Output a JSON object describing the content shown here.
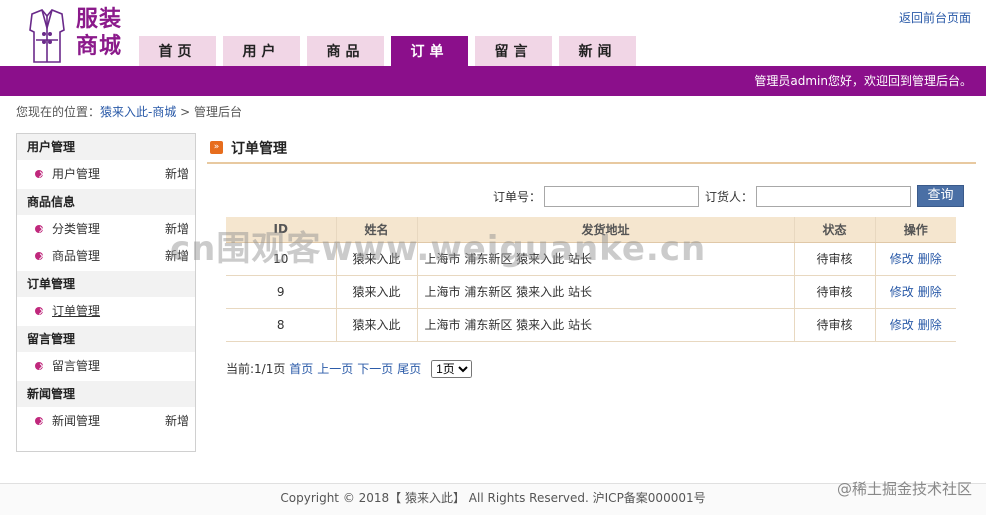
{
  "header": {
    "logo_text_line1": "服装",
    "logo_text_line2": "商城",
    "back_link": "返回前台页面",
    "nav": [
      "首页",
      "用户",
      "商品",
      "订单",
      "留言",
      "新闻"
    ],
    "active_nav": 3,
    "welcome": "管理员admin您好，欢迎回到管理后台。"
  },
  "breadcrumb": {
    "prefix": "您现在的位置：",
    "site": "猿来入此-商城",
    "sep": " > ",
    "current": "管理后台"
  },
  "sidebar": {
    "groups": [
      {
        "title": "用户管理",
        "items": [
          {
            "label": "用户管理",
            "add": "新增"
          }
        ]
      },
      {
        "title": "商品信息",
        "items": [
          {
            "label": "分类管理",
            "add": "新增"
          },
          {
            "label": "商品管理",
            "add": "新增"
          }
        ]
      },
      {
        "title": "订单管理",
        "items": [
          {
            "label": "订单管理",
            "add": ""
          }
        ]
      },
      {
        "title": "留言管理",
        "items": [
          {
            "label": "留言管理",
            "add": ""
          }
        ]
      },
      {
        "title": "新闻管理",
        "items": [
          {
            "label": "新闻管理",
            "add": "新增"
          }
        ]
      }
    ]
  },
  "main": {
    "title": "订单管理",
    "search": {
      "order_no_label": "订单号：",
      "order_no_value": "",
      "customer_label": "订货人：",
      "customer_value": "",
      "button": "查询"
    },
    "table": {
      "headers": [
        "ID",
        "姓名",
        "发货地址",
        "状态",
        "操作"
      ],
      "rows": [
        {
          "id": "10",
          "name": "猿来入此",
          "address": "上海市 浦东新区 猿来入此 站长",
          "status": "待审核"
        },
        {
          "id": "9",
          "name": "猿来入此",
          "address": "上海市 浦东新区 猿来入此 站长",
          "status": "待审核"
        },
        {
          "id": "8",
          "name": "猿来入此",
          "address": "上海市 浦东新区 猿来入此 站长",
          "status": "待审核"
        }
      ],
      "edit_label": "修改",
      "delete_label": "删除"
    },
    "pager": {
      "current": "当前:1/1页",
      "first": "首页",
      "prev": "上一页",
      "next": "下一页",
      "last": "尾页",
      "select_value": "1页"
    }
  },
  "footer": {
    "text": "Copyright © 2018【 猿来入此】 All Rights Reserved. 沪ICP备案000001号",
    "watermark": "@稀土掘金技术社区",
    "big_watermark": "cn围观客www.weiguanke.cn"
  },
  "colors": {
    "brand": "#8b0f8b",
    "nav_inactive": "#f1d6e6",
    "button": "#4a6fa5"
  }
}
